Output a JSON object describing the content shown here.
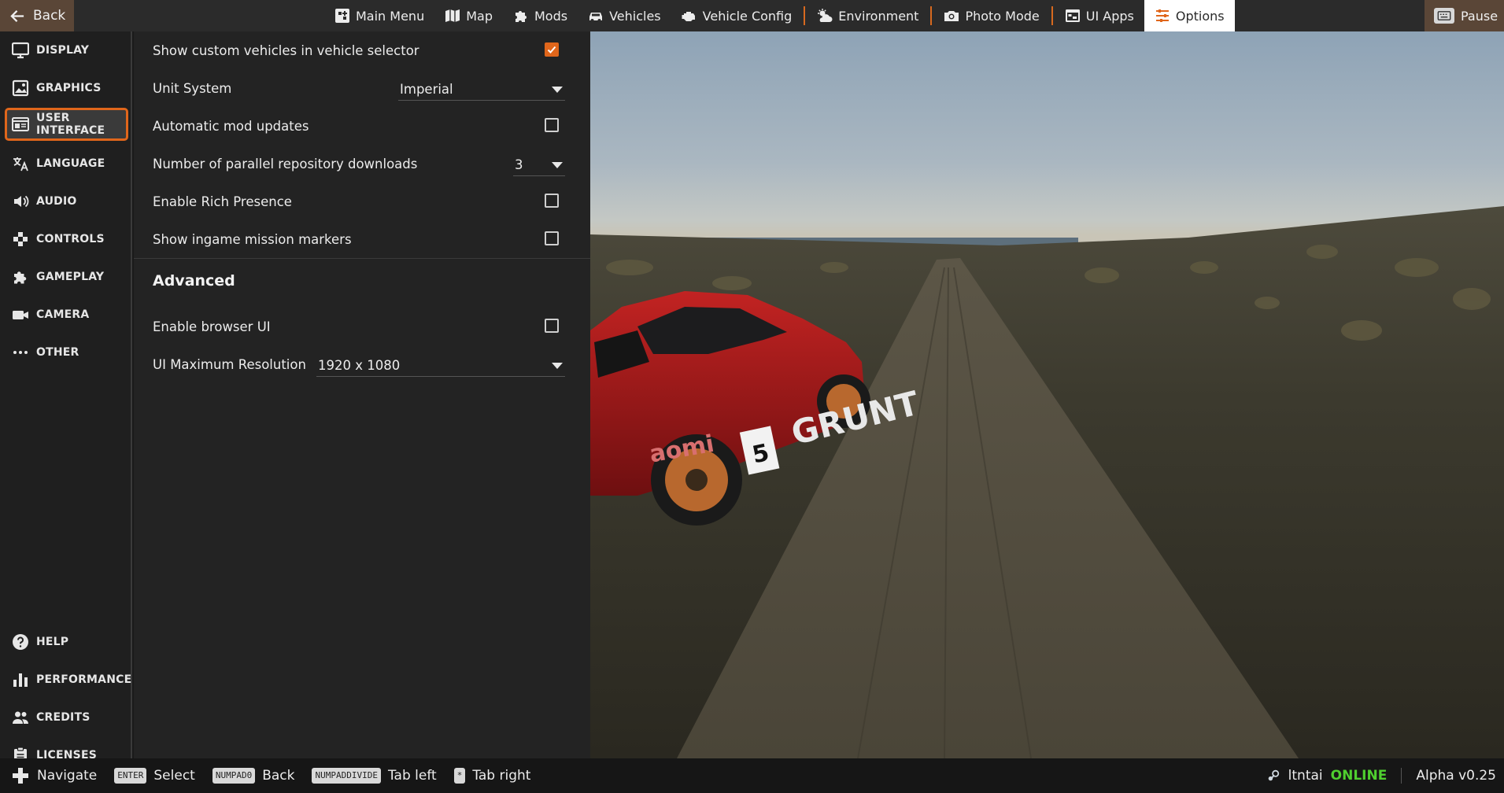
{
  "topbar": {
    "back_label": "Back",
    "tabs": [
      {
        "label": "Main Menu",
        "icon": "main-menu-icon"
      },
      {
        "label": "Map",
        "icon": "map-icon"
      },
      {
        "label": "Mods",
        "icon": "puzzle-icon"
      },
      {
        "label": "Vehicles",
        "icon": "car-icon"
      },
      {
        "label": "Vehicle Config",
        "icon": "engine-icon"
      },
      {
        "label": "Environment",
        "icon": "weather-icon"
      },
      {
        "label": "Photo Mode",
        "icon": "camera-icon"
      },
      {
        "label": "UI Apps",
        "icon": "ui-apps-icon"
      },
      {
        "label": "Options",
        "icon": "sliders-icon",
        "active": true
      }
    ],
    "pause_label": "Pause"
  },
  "sidebar": {
    "items": [
      {
        "label": "DISPLAY",
        "icon": "monitor-icon"
      },
      {
        "label": "GRAPHICS",
        "icon": "image-icon"
      },
      {
        "label": "USER INTERFACE",
        "icon": "ui-window-icon",
        "active": true
      },
      {
        "label": "LANGUAGE",
        "icon": "translate-icon"
      },
      {
        "label": "AUDIO",
        "icon": "speaker-icon"
      },
      {
        "label": "CONTROLS",
        "icon": "gamepad-icon"
      },
      {
        "label": "GAMEPLAY",
        "icon": "puzzle-icon"
      },
      {
        "label": "CAMERA",
        "icon": "video-camera-icon"
      },
      {
        "label": "OTHER",
        "icon": "more-icon"
      }
    ],
    "bottom_items": [
      {
        "label": "HELP",
        "icon": "help-icon"
      },
      {
        "label": "PERFORMANCE",
        "icon": "bar-chart-icon"
      },
      {
        "label": "CREDITS",
        "icon": "people-icon"
      },
      {
        "label": "LICENSES",
        "icon": "clipboard-icon"
      }
    ]
  },
  "settings": {
    "show_custom_vehicles": {
      "label": "Show custom vehicles in vehicle selector",
      "checked": true
    },
    "unit_system": {
      "label": "Unit System",
      "value": "Imperial"
    },
    "auto_mod_updates": {
      "label": "Automatic mod updates",
      "checked": false
    },
    "parallel_downloads": {
      "label": "Number of parallel repository downloads",
      "value": "3"
    },
    "rich_presence": {
      "label": "Enable Rich Presence",
      "checked": false
    },
    "mission_markers": {
      "label": "Show ingame mission markers",
      "checked": false
    },
    "advanced_title": "Advanced",
    "browser_ui": {
      "label": "Enable browser UI",
      "checked": false
    },
    "ui_max_resolution": {
      "label": "UI Maximum Resolution",
      "value": "1920 x 1080"
    }
  },
  "scene": {
    "car_brand_text": "GRUNT",
    "car_side_text": "aomi",
    "car_number": "5"
  },
  "bottombar": {
    "navigate_label": "Navigate",
    "select_key": "ENTER",
    "select_label": "Select",
    "back_key": "NUMPAD0",
    "back_label": "Back",
    "tab_left_key": "NUMPADDIVIDE",
    "tab_left_label": "Tab left",
    "tab_right_key": "*",
    "tab_right_label": "Tab right",
    "username": "ltntai",
    "online_status": "ONLINE",
    "version": "Alpha v0.25"
  },
  "colors": {
    "accent": "#e0661b",
    "online": "#4fcf2f",
    "panel_bg": "#232323",
    "sidebar_bg": "#1f1f1f",
    "topbar_bg": "#2b2b2b"
  }
}
